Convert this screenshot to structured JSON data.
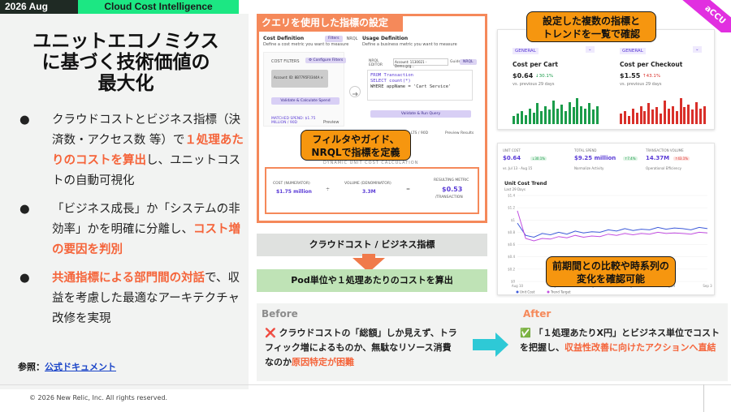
{
  "header": {
    "year": "2026 Aug",
    "name": "Cloud Cost Intelligence",
    "corner": "aCCU"
  },
  "title": [
    "ユニットエコノミクス",
    "に基づく技術価値の",
    "最大化"
  ],
  "bullets": [
    {
      "dot": "●",
      "parts": [
        {
          "t": "クラウドコストとビジネス指標（決済数・アクセス数 等）で",
          "hl": false
        },
        {
          "t": "１処理あたりのコストを算出",
          "hl": true
        },
        {
          "t": "し、ユニットコストの自動可視化",
          "hl": false
        }
      ]
    },
    {
      "dot": "●",
      "parts": [
        {
          "t": "「ビジネス成長」か「システムの非効率」かを明確に分離し、",
          "hl": false
        },
        {
          "t": "コスト増の要因を判別",
          "hl": true
        }
      ]
    },
    {
      "dot": "●",
      "parts": [
        {
          "t": "共通指標による部門間の対話",
          "hl": true
        },
        {
          "t": "で、収益を考慮した最適なアーキテクチャ改修を実現",
          "hl": false
        }
      ]
    }
  ],
  "reference": {
    "label": "参照：",
    "link": "公式ドキュメント"
  },
  "copyright": "© 2026 New Relic, Inc. All rights reserved.",
  "query_panel": {
    "title": "クエリを使用した指標の設定",
    "cost_def": "Cost Definition",
    "cost_def_sub": "Define a cost metric you want to measure",
    "toggle_filters": "Filters",
    "toggle_nrql": "NRQL",
    "cost_filters": "COST FILTERS",
    "configure_filters": "⚙ Configure Filters",
    "account_chip": "Account: ID: 8B7795F0344A  ×",
    "validate_btn": "Validate & Calculate Spend",
    "matched_spend": "MATCHED SPEND: $1.75 MILLION / 90D",
    "preview": "Preview",
    "usage_def": "Usage Definition",
    "usage_def_sub": "Define a business metric you want to measure",
    "nrql_editor": "NRQL EDITOR",
    "account_select": "Account: 1130021 - Demo.gcg...",
    "guided": "Guided",
    "nrql": "NRQL",
    "code": [
      "FROM Transaction",
      "SELECT count(*)",
      "WHERE appName = 'Cart Service'"
    ],
    "validate_run": "Validate & Run Query",
    "preview_results": "Preview Results",
    "results_tail": "LTS / 90D",
    "dynamic_title": "DYNAMIC UNIT COST CALCULATION",
    "cost_label": "COST (NUMERATOR)",
    "cost_val": "$1.75 million",
    "volume_label": "VOLUME (DENOMINATOR)",
    "volume_val": "3.3M",
    "resulting_label": "RESULTING METRIC",
    "resulting_val": "$0.53",
    "resulting_unit": "/TRANSACTION",
    "divide": "÷",
    "equals": "="
  },
  "callouts": {
    "filter": [
      "フィルタやガイド、",
      "NRQLで指標を定義"
    ],
    "trend": [
      "設定した複数の指標と",
      "トレンドを一覧で確認"
    ],
    "compare": [
      "前期間との比較や時系列の",
      "変化を確認可能"
    ]
  },
  "flow": {
    "step1": "クラウドコスト / ビジネス指標",
    "step2": "Pod単位や１処理あたりのコストを算出"
  },
  "before": {
    "title": "Before",
    "icon": "❌",
    "text": "クラウドコストの「総額」しか見えず、トラフィック増によるものか、無駄なリソース消費なのか",
    "bad": "原因特定が困難"
  },
  "after": {
    "title": "After",
    "icon": "✅",
    "text": "「１処理あたりX円」とビジネス単位でコストを把握し、",
    "good": "収益性改善に向けたアクションへ直結"
  },
  "dash1": {
    "cards": [
      {
        "tag": "GENERAL",
        "name": "Cost per Cart",
        "value": "$0.64",
        "delta": "↓30.1%",
        "delta_dir": "down",
        "sub": "vs. previous 29 days",
        "bar_color": "#1a9c4a",
        "bars": [
          0.3,
          0.4,
          0.5,
          0.35,
          0.6,
          0.45,
          0.8,
          0.5,
          0.7,
          0.55,
          0.9,
          0.6,
          0.75,
          0.5,
          0.85,
          0.65,
          1.0,
          0.7,
          0.6,
          0.8,
          0.55,
          0.7
        ]
      },
      {
        "tag": "GENERAL",
        "name": "Cost per Checkout",
        "value": "$1.55",
        "delta": "↑43.1%",
        "delta_dir": "up",
        "sub": "vs. previous 29 days",
        "bar_color": "#d9302a",
        "bars": [
          0.4,
          0.5,
          0.3,
          0.6,
          0.45,
          0.7,
          0.5,
          0.8,
          0.55,
          0.65,
          0.4,
          0.9,
          0.6,
          0.7,
          0.5,
          1.0,
          0.65,
          0.75,
          0.55,
          0.85,
          0.6,
          0.7
        ]
      }
    ],
    "chevron": "⌄"
  },
  "dash2": {
    "stats": [
      {
        "label": "UNIT COST",
        "value": "$0.64",
        "badge": "↓30.1%",
        "dir": "down",
        "sub": "vs. Jul 13 - Aug 15"
      },
      {
        "label": "TOTAL SPEND",
        "value": "$9.25 million",
        "badge": "↑7.4%",
        "dir": "down",
        "sub": "Normalize Activity"
      },
      {
        "label": "TRANSACTION VOLUME",
        "value": "14.37M",
        "badge": "↑43.1%",
        "dir": "up",
        "sub": "Operational Efficiency"
      }
    ],
    "chart_data": {
      "type": "line",
      "title": "Unit Cost Trend",
      "subtitle": "Last 29 Days",
      "y_ticks": [
        "$1.4",
        "$1.2",
        "$1",
        "$0.8",
        "$0.6",
        "$0.4",
        "$0.2",
        "$0"
      ],
      "ylim": [
        0,
        1.4
      ],
      "x_ticks": [
        "Aug 10",
        "Aug 14",
        "Aug 19",
        "Aug 24",
        "Aug 29",
        "Sep 3"
      ],
      "series": [
        {
          "name": "Unit Cost",
          "color": "#3d5ad9",
          "values": [
            0.95,
            0.75,
            0.72,
            0.78,
            0.76,
            0.8,
            0.77,
            0.82,
            0.79,
            0.81,
            0.8,
            0.84,
            0.82,
            0.86,
            0.83,
            0.85,
            0.84,
            0.88,
            0.85,
            0.87,
            0.86,
            0.84,
            0.88,
            0.86
          ]
        },
        {
          "name": "Trend Target",
          "color": "#c14ee0",
          "values": [
            1.15,
            0.7,
            0.66,
            0.7,
            0.69,
            0.73,
            0.71,
            0.75,
            0.72,
            0.74,
            0.73,
            0.77,
            0.75,
            0.78,
            0.76,
            0.78,
            0.77,
            0.8,
            0.78,
            0.79,
            0.78,
            0.77,
            0.8,
            0.79
          ]
        }
      ]
    }
  }
}
